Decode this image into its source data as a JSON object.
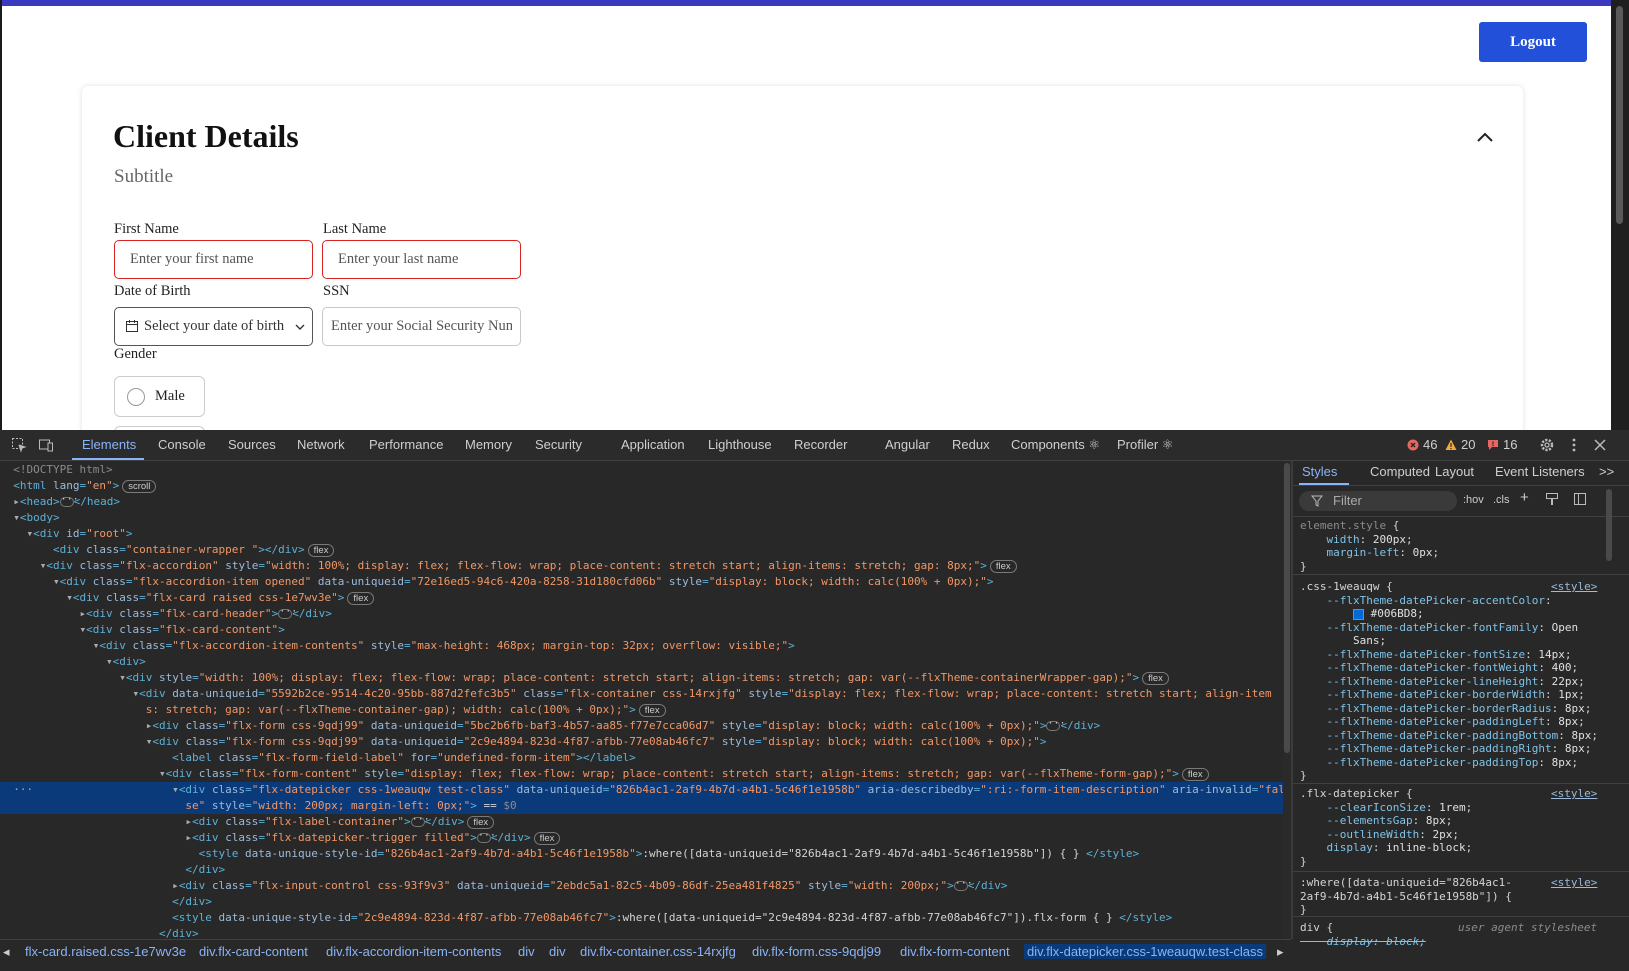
{
  "page": {
    "logout_label": "Logout",
    "card_title": "Client Details",
    "card_subtitle": "Subtitle",
    "first_name_label": "First Name",
    "first_name_placeholder": "Enter your first name",
    "last_name_label": "Last Name",
    "last_name_placeholder": "Enter your last name",
    "dob_label": "Date of Birth",
    "dob_placeholder": "Select your date of birth",
    "ssn_label": "SSN",
    "ssn_placeholder": "Enter your Social Security Numl",
    "gender_label": "Gender",
    "gender_options": [
      "Male"
    ]
  },
  "devtools": {
    "tabs": [
      "Elements",
      "Console",
      "Sources",
      "Network",
      "Performance",
      "Memory",
      "Security",
      "Application",
      "Lighthouse",
      "Recorder",
      "Angular",
      "Redux",
      "Components ⚛",
      "Profiler ⚛"
    ],
    "active_tab": "Elements",
    "error_count": "46",
    "warning_count": "20",
    "issue_count": "16",
    "breadcrumb": [
      "flx-card.raised.css-1e7wv3e",
      "div.flx-card-content",
      "div.flx-accordion-item-contents",
      "div",
      "div",
      "div.flx-container.css-14rxjfg",
      "div.flx-form.css-9qdj99",
      "div.flx-form-content",
      "div.flx-datepicker.css-1weauqw.test-class"
    ],
    "styles_tabs": [
      "Styles",
      "Computed",
      "Layout",
      "Event Listeners"
    ],
    "filter_placeholder": "Filter",
    "hov_label": ":hov",
    "cls_label": ".cls",
    "style_source": "<style>",
    "user_agent_label": "user agent stylesheet",
    "accent_color": "#006BD8"
  }
}
